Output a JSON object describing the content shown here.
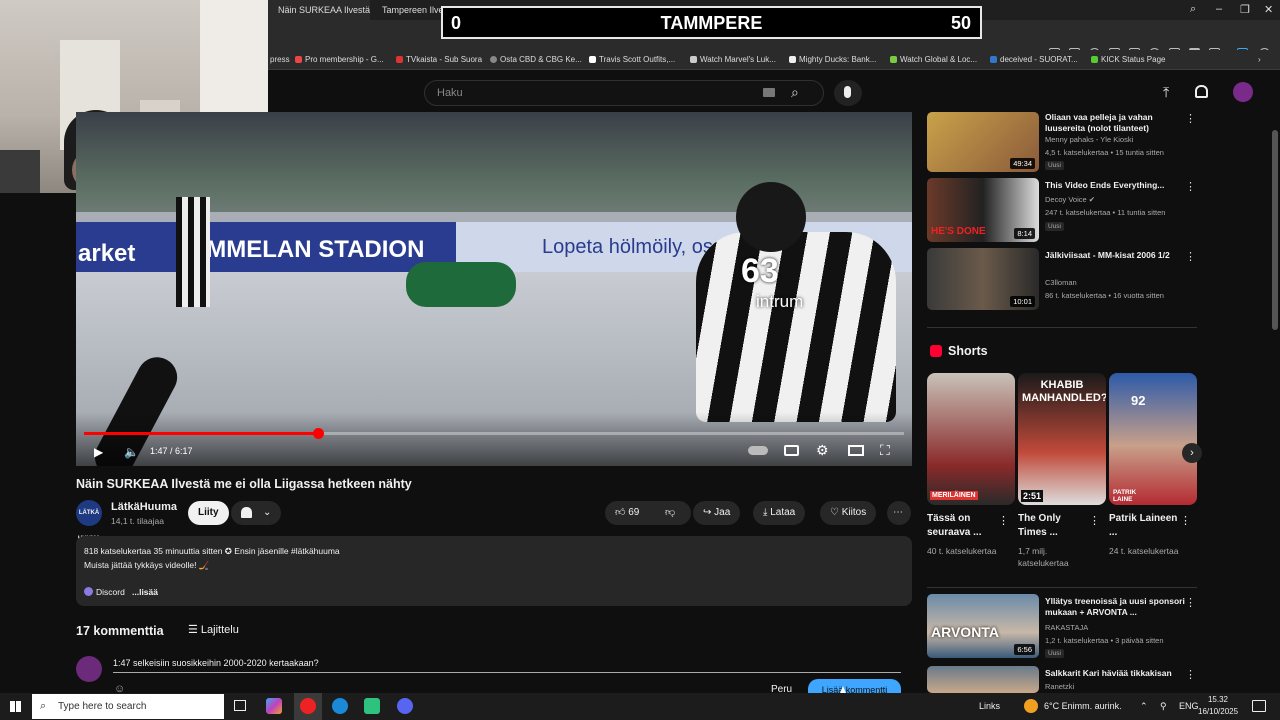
{
  "browser": {
    "tabs": [
      {
        "label": "Näin SURKEAA Ilvestä me",
        "active": true
      },
      {
        "label": "Tampereen Ilves - Etusivu",
        "active": false
      }
    ],
    "bookmarks": [
      "press",
      "Pro membership - G...",
      "TVkaista - Sub Suora",
      "Osta CBD & CBG Ke...",
      "Travis Scott Outfits,...",
      "Watch Marvel's Luk...",
      "Mighty Ducks: Bank...",
      "Watch Global & Loc...",
      "deceived - SUORAT...",
      "KICK Status Page"
    ]
  },
  "scoreboard": {
    "left_score": "0",
    "team": "TAMMPERE",
    "right_score": "50"
  },
  "youtube": {
    "search_placeholder": "Haku",
    "video": {
      "time": "1:47 / 6:17",
      "progress_fraction": 0.285,
      "overlay_texts": [
        "arket",
        "TAMMELAN STADION",
        "Lopeta hölmöily, os",
        "63",
        "intrum"
      ]
    },
    "title": "Näin SURKEAA Ilvestä me ei olla Liigassa hetkeen nähty",
    "channel": {
      "avatar_text": "LÄTKÄ HUUMA",
      "name": "LätkäHuuma",
      "subs": "14,1 t. tilaajaa",
      "join": "Liity"
    },
    "actions": {
      "likes": "69",
      "share": "Jaa",
      "download": "Lataa",
      "thanks": "Kiitos",
      "more": "⋯"
    },
    "description": {
      "line1": "818 katselukertaa  35 minuuttia sitten  ✪ Ensin jäsenille  #lätkähuuma",
      "line2": "Muista jättää tykkäys videolle! 🏒",
      "discord": "Discord",
      "more": "...lisää"
    },
    "comments": {
      "count": "17 kommenttia",
      "sort": "Lajittelu",
      "draft": "1:47 selkeisiin suosikkeihin 2000-2020 kertaakaan?",
      "cancel": "Peru",
      "submit": "Lisää kommentti"
    },
    "recommended": [
      {
        "title": "Oliaan vaa pelleja ja vahan luusereita (nolot tilanteet)",
        "channel": "Menny pahaks - Yle Kioski",
        "meta": "4,5 t. katselukertaa • 15 tuntia sitten",
        "badge": "Uusi",
        "duration": "49:34"
      },
      {
        "title": "This Video Ends Everything...",
        "channel": "Decoy Voice ✔",
        "meta": "247 t. katselukertaa • 11 tuntia sitten",
        "badge": "Uusi",
        "duration": "8:14",
        "thumb_text": "HE'S DONE"
      },
      {
        "title": "Jälkiviisaat - MM-kisat 2006 1/2",
        "channel": "C3lloman",
        "meta": "86 t. katselukertaa • 16 vuotta sitten",
        "duration": "10:01"
      }
    ],
    "shorts_heading": "Shorts",
    "shorts": [
      {
        "title": "Tässä on seuraava ...",
        "views": "40 t. katselukertaa",
        "thumb_text": "MERILÄINEN"
      },
      {
        "title": "The Only Times ...",
        "views": "1,7 milj. katselukertaa",
        "thumb_text": "KHABIB MANHANDLED?",
        "time": "2:51"
      },
      {
        "title": "Patrik Laineen ...",
        "views": "24 t. katselukertaa",
        "thumb_text": "PATRIK LAINE",
        "number": "92"
      }
    ],
    "recommended2": [
      {
        "title": "Yllätys treenoissä ja uusi sponsori mukaan + ARVONTA ...",
        "channel": "RAKASTAJA",
        "meta": "1,2 t. katselukertaa • 3 päivää sitten",
        "badge": "Uusi",
        "duration": "6:56",
        "thumb_text": "ARVONTA"
      },
      {
        "title": "Salkkarit Kari häviää tikkakisan",
        "channel": "Ranetzki"
      }
    ]
  },
  "taskbar": {
    "search": "Type here to search",
    "links": "Links",
    "weather": "6°C  Enimm. aurink.",
    "lang": "ENG",
    "time": "15.32",
    "date": "16/10/2025"
  }
}
